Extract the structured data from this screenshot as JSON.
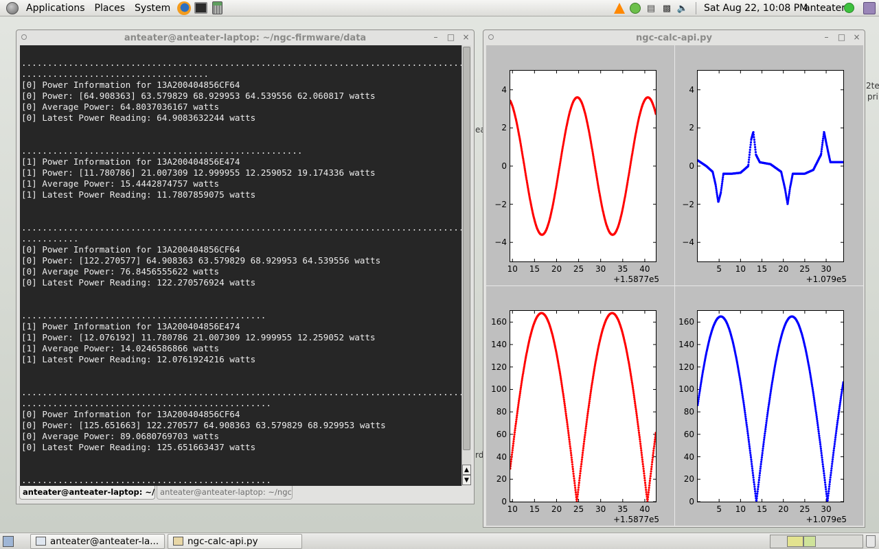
{
  "top_panel": {
    "menus": [
      "Applications",
      "Places",
      "System"
    ],
    "launchers": [
      "firefox-icon",
      "terminal-icon",
      "calculator-icon"
    ],
    "clock": "Sat Aug 22, 10:08 PM",
    "username": "anteater"
  },
  "terminal": {
    "title": "anteater@anteater-laptop: ~/ngc-firmware/data",
    "lines": [
      "",
      ".............................................................................................................",
      "....................................",
      "[0] Power Information for 13A200404856CF64",
      "[0] Power: [64.908363] 63.579829 68.929953 64.539556 62.060817 watts",
      "[0] Average Power: 64.8037036167 watts",
      "[0] Latest Power Reading: 64.9083632244 watts",
      "",
      "",
      "......................................................",
      "[1] Power Information for 13A200404856E474",
      "[1] Power: [11.780786] 21.007309 12.999955 12.259052 19.174336 watts",
      "[1] Average Power: 15.4442874757 watts",
      "[1] Latest Power Reading: 11.7807859075 watts",
      "",
      "",
      ".............................................................................................................",
      "...........",
      "[0] Power Information for 13A200404856CF64",
      "[0] Power: [122.270577] 64.908363 63.579829 68.929953 64.539556 watts",
      "[0] Average Power: 76.8456555622 watts",
      "[0] Latest Power Reading: 122.270576924 watts",
      "",
      "",
      "...............................................",
      "[1] Power Information for 13A200404856E474",
      "[1] Power: [12.076192] 11.780786 21.007309 12.999955 12.259052 watts",
      "[1] Average Power: 14.0246586866 watts",
      "[1] Latest Power Reading: 12.0761924216 watts",
      "",
      "",
      ".............................................................................................................",
      "................................................",
      "[0] Power Information for 13A200404856CF64",
      "[0] Power: [125.651663] 122.270577 64.908363 63.579829 68.929953 watts",
      "[0] Average Power: 89.0680769703 watts",
      "[0] Latest Power Reading: 125.651663437 watts",
      "",
      "",
      "................................................"
    ],
    "tabs": [
      "anteater@anteater-laptop: ~/ngc",
      "anteater@anteater-laptop: ~/ngc-firm"
    ]
  },
  "plot_window": {
    "title": "ngc-calc-api.py"
  },
  "background_fragments": [
    "pri",
    "rd",
    "ea",
    "2te"
  ],
  "chart_data": [
    {
      "type": "scatter",
      "name": "top-left",
      "color": "#ff0000",
      "x_offset": "+1.5877e5",
      "xlim": [
        9.5,
        42.5
      ],
      "ylim": [
        -5,
        5
      ],
      "xticks": [
        10,
        15,
        20,
        25,
        30,
        35,
        40
      ],
      "yticks": [
        -4,
        -2,
        0,
        2,
        4
      ],
      "wave": {
        "kind": "sine",
        "amplitude": 3.6,
        "period": 16.0,
        "phase_x_at_peak": 24.7
      },
      "x_range": [
        9.5,
        42.5
      ]
    },
    {
      "type": "scatter",
      "name": "top-right",
      "color": "#0000ff",
      "x_offset": "+1.079e5",
      "xlim": [
        0,
        34
      ],
      "ylim": [
        -5,
        5
      ],
      "xticks": [
        5,
        10,
        15,
        20,
        25,
        30
      ],
      "yticks": [
        -4,
        -2,
        0,
        2,
        4
      ],
      "profile": [
        [
          0,
          0.3
        ],
        [
          2,
          0.0
        ],
        [
          3.5,
          -0.3
        ],
        [
          4.2,
          -1.0
        ],
        [
          4.8,
          -1.9
        ],
        [
          5.4,
          -1.4
        ],
        [
          6.0,
          -0.4
        ],
        [
          8,
          -0.4
        ],
        [
          10,
          -0.35
        ],
        [
          11.8,
          0.0
        ],
        [
          12.5,
          1.4
        ],
        [
          13.0,
          1.8
        ],
        [
          13.6,
          0.6
        ],
        [
          14.5,
          0.2
        ],
        [
          17,
          0.1
        ],
        [
          19.5,
          -0.3
        ],
        [
          20.4,
          -1.2
        ],
        [
          21.0,
          -2.0
        ],
        [
          21.6,
          -1.1
        ],
        [
          22.2,
          -0.4
        ],
        [
          25,
          -0.4
        ],
        [
          27,
          -0.2
        ],
        [
          28.8,
          0.6
        ],
        [
          29.5,
          1.8
        ],
        [
          30.4,
          0.8
        ],
        [
          31.0,
          0.2
        ],
        [
          34,
          0.2
        ]
      ]
    },
    {
      "type": "scatter",
      "name": "bottom-left",
      "color": "#ff0000",
      "x_offset": "+1.5877e5",
      "xlim": [
        9.5,
        42.5
      ],
      "ylim": [
        0,
        170
      ],
      "xticks": [
        10,
        15,
        20,
        25,
        30,
        35,
        40
      ],
      "yticks": [
        0,
        20,
        40,
        60,
        80,
        100,
        120,
        140,
        160
      ],
      "wave": {
        "kind": "abs_sine",
        "amplitude": 168,
        "period": 16.0,
        "phase_x_at_peak": 16.6
      },
      "x_range": [
        9.5,
        42.5
      ]
    },
    {
      "type": "scatter",
      "name": "bottom-right",
      "color": "#0000ff",
      "x_offset": "+1.079e5",
      "xlim": [
        0,
        34
      ],
      "ylim": [
        0,
        170
      ],
      "xticks": [
        5,
        10,
        15,
        20,
        25,
        30
      ],
      "yticks": [
        0,
        20,
        40,
        60,
        80,
        100,
        120,
        140,
        160
      ],
      "wave": {
        "kind": "abs_sine",
        "amplitude": 165,
        "period": 16.6,
        "phase_x_at_peak": 5.4
      },
      "x_range": [
        0,
        34
      ]
    }
  ],
  "taskbar": {
    "items": [
      "anteater@anteater-la...",
      "ngc-calc-api.py"
    ]
  }
}
